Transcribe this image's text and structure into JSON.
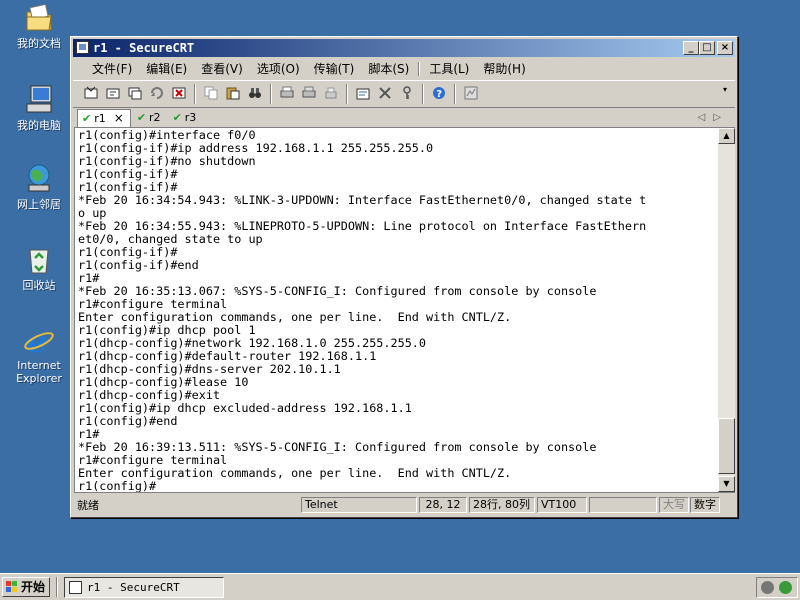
{
  "desktop": {
    "icons": [
      {
        "label": "我的文档",
        "icon": "my-documents-icon"
      },
      {
        "label": "我的电脑",
        "icon": "my-computer-icon"
      },
      {
        "label": "网上邻居",
        "icon": "network-places-icon"
      },
      {
        "label": "回收站",
        "icon": "recycle-bin-icon"
      },
      {
        "label": "Internet Explorer",
        "icon": "internet-explorer-icon"
      }
    ]
  },
  "window": {
    "title": "r1 - SecureCRT",
    "menu": [
      "文件(F)",
      "编辑(E)",
      "查看(V)",
      "选项(O)",
      "传输(T)",
      "脚本(S)",
      "工具(L)",
      "帮助(H)"
    ],
    "tabs": [
      {
        "label": "r1",
        "active": true
      },
      {
        "label": "r2",
        "active": false
      },
      {
        "label": "r3",
        "active": false
      }
    ],
    "tab_close": "×",
    "tab_check": "✔",
    "terminal_lines": [
      "r1(config)#interface f0/0",
      "r1(config-if)#ip address 192.168.1.1 255.255.255.0",
      "r1(config-if)#no shutdown",
      "r1(config-if)#",
      "r1(config-if)#",
      "*Feb 20 16:34:54.943: %LINK-3-UPDOWN: Interface FastEthernet0/0, changed state t",
      "o up",
      "*Feb 20 16:34:55.943: %LINEPROTO-5-UPDOWN: Line protocol on Interface FastEthern",
      "et0/0, changed state to up",
      "r1(config-if)#",
      "r1(config-if)#end",
      "r1#",
      "*Feb 20 16:35:13.067: %SYS-5-CONFIG_I: Configured from console by console",
      "r1#configure terminal",
      "Enter configuration commands, one per line.  End with CNTL/Z.",
      "r1(config)#ip dhcp pool 1",
      "r1(dhcp-config)#network 192.168.1.0 255.255.255.0",
      "r1(dhcp-config)#default-router 192.168.1.1",
      "r1(dhcp-config)#dns-server 202.10.1.1",
      "r1(dhcp-config)#lease 10",
      "r1(dhcp-config)#exit",
      "r1(config)#ip dhcp excluded-address 192.168.1.1",
      "r1(config)#end",
      "r1#",
      "*Feb 20 16:39:13.511: %SYS-5-CONFIG_I: Configured from console by console",
      "r1#configure terminal",
      "Enter configuration commands, one per line.  End with CNTL/Z.",
      "r1(config)#"
    ],
    "status": {
      "ready": "就绪",
      "protocol": "Telnet",
      "cursor": "28, 12",
      "size": "28行, 80列",
      "emulation": "VT100",
      "blank": "",
      "caps": "大写",
      "num": "数字"
    }
  },
  "taskbar": {
    "start_label": "开始",
    "task_title": "r1 - SecureCRT"
  },
  "colors": {
    "desktop": "#3a6ea5",
    "titlebar_start": "#0a246a",
    "titlebar_end": "#a6caf0",
    "tab_check": "#1fa02a"
  }
}
